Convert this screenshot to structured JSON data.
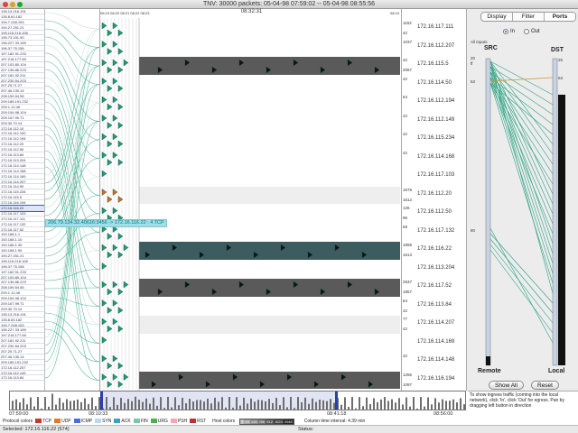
{
  "window": {
    "title": "TNV: 30000 packets: 05-04-98 07:59:02 -- 05-04-98 08:55:56"
  },
  "matrix": {
    "center_time": "08:32:31",
    "top_labels": "08:19 08:20 08:21 08:22 08:23",
    "right_top_label": "08:24",
    "rows": [
      {
        "ip": "172.16.117.111",
        "count_top": "1163",
        "count_bot": "42",
        "bg": "#ffffff"
      },
      {
        "ip": "172.16.112.207",
        "count_top": "1037",
        "count_bot": "",
        "bg": "#ffffff"
      },
      {
        "ip": "172.16.115.5",
        "count_top": "42",
        "count_bot": "2067",
        "bg": "#5a5a5a"
      },
      {
        "ip": "172.16.114.50",
        "count_top": "42",
        "count_bot": "",
        "bg": "#ffffff"
      },
      {
        "ip": "172.16.112.194",
        "count_top": "54",
        "count_bot": "",
        "bg": "#ffffff"
      },
      {
        "ip": "172.16.112.149",
        "count_top": "42",
        "count_bot": "",
        "bg": "#ffffff"
      },
      {
        "ip": "172.16.115.234",
        "count_top": "42",
        "count_bot": "",
        "bg": "#ffffff"
      },
      {
        "ip": "172.16.114.168",
        "count_top": "42",
        "count_bot": "",
        "bg": "#ffffff"
      },
      {
        "ip": "172.16.117.103",
        "count_top": "",
        "count_bot": "",
        "bg": "#ffffff"
      },
      {
        "ip": "172.16.112.20",
        "count_top": "1678",
        "count_bot": "1612",
        "bg": "#eeeeee"
      },
      {
        "ip": "172.16.112.50",
        "count_top": "126",
        "count_bot": "96",
        "bg": "#ffffff"
      },
      {
        "ip": "172.16.117.132",
        "count_top": "69",
        "count_bot": "",
        "bg": "#ffffff"
      },
      {
        "ip": "172.16.116.22",
        "count_top": "1968",
        "count_bot": "1513",
        "bg": "#3d5c60"
      },
      {
        "ip": "172.16.113.204",
        "count_top": "",
        "count_bot": "",
        "bg": "#ffffff"
      },
      {
        "ip": "172.16.117.52",
        "count_top": "2537",
        "count_bot": "1857",
        "bg": "#5a5a5a"
      },
      {
        "ip": "172.16.113.84",
        "count_top": "64",
        "count_bot": "42",
        "bg": "#ffffff"
      },
      {
        "ip": "172.16.114.207",
        "count_top": "77",
        "count_bot": "42",
        "bg": "#eeeeee"
      },
      {
        "ip": "172.16.114.169",
        "count_top": "",
        "count_bot": "",
        "bg": "#ffffff"
      },
      {
        "ip": "172.16.114.148",
        "count_top": "42",
        "count_bot": "",
        "bg": "#ffffff"
      },
      {
        "ip": "172.16.116.194",
        "count_top": "1256",
        "count_bot": "1097",
        "bg": "#5a5a5a"
      }
    ]
  },
  "tooltip": {
    "text": "206.79.134.32.40616:3456 -> 172.16.116.22 : 4 TCP"
  },
  "panel": {
    "tabs": [
      "Display",
      "Filter",
      "Ports"
    ],
    "active_tab": "Ports",
    "radio_in": "In",
    "radio_out": "Out",
    "radio_selected": "In",
    "all_inputs": "All Inputs",
    "src_label": "SRC",
    "dst_label": "DST",
    "src_numbers": [
      "20",
      "ff",
      "53",
      "80"
    ],
    "dst_numbers": [
      "25",
      "53"
    ],
    "remote_label": "Remote",
    "local_label": "Local",
    "show_all_label": "Show All",
    "reset_label": "Reset"
  },
  "timeline": {
    "ticks": [
      "07:59:00",
      "08:10:33",
      "08:41:18",
      "08:56:00"
    ],
    "interval_label": "Column time interval: 4.39 min"
  },
  "legend": {
    "protocol_label": "Protocol colors",
    "protocols": [
      {
        "name": "TCP",
        "color": "#c0392b"
      },
      {
        "name": "UDP",
        "color": "#e07b2e"
      },
      {
        "name": "ICMP",
        "color": "#4a6fd4"
      },
      {
        "name": "SYN",
        "color": "#b9d8f0"
      },
      {
        "name": "ACK",
        "color": "#3aa0c8"
      },
      {
        "name": "FIN",
        "color": "#7ec6a8"
      },
      {
        "name": "URG",
        "color": "#48b04a"
      },
      {
        "name": "PSH",
        "color": "#f2a7b5"
      },
      {
        "name": "RST",
        "color": "#c03030"
      }
    ],
    "host_label": "Host colors",
    "host_scale": [
      "1",
      "53",
      "128",
      "256",
      "512",
      "1024",
      "2048"
    ]
  },
  "status": {
    "selected": "Selected:  172.16.116.22 (574)",
    "status": "Status:"
  },
  "help": {
    "text": "To show ingress traffic (coming into the local network), click 'In', click 'Out' for egress. Pan by dragging left button in direction"
  },
  "hostlist": {
    "items": [
      "135.13.216.191",
      "135.8.60.182",
      "194.7.248.153",
      "194.27.251.21",
      "195.115.218.108",
      "195.73.151.50",
      "196.227.33.189",
      "196.37.75.158",
      "197.182.91.233",
      "197.218.177.69",
      "207.103.80.104",
      "207.136.86.223",
      "207.181.92.211",
      "207.230.54.203",
      "207.25.71.27",
      "207.46.130.14",
      "208.159.54.55",
      "209.185.191.232",
      "209.1.12.46",
      "209.154.98.104",
      "209.167.99.71",
      "209.30.70.14",
      "172.16.112.10",
      "172.16.112.100",
      "172.16.112.194",
      "172.16.112.20",
      "172.16.112.50",
      "172.16.113.84",
      "172.16.113.204",
      "172.16.114.148",
      "172.16.114.168",
      "172.16.114.169",
      "172.16.114.207",
      "172.16.114.50",
      "172.16.115.234",
      "172.16.115.5",
      "172.16.116.194",
      "172.16.116.22",
      "172.16.117.103",
      "172.16.117.111",
      "172.16.117.132",
      "172.16.117.52",
      "192.168.1.1",
      "192.168.1.10",
      "192.168.1.30",
      "192.168.1.90",
      "194.27.251.21",
      "195.115.218.108",
      "196.37.75.158",
      "197.182.91.233",
      "207.103.80.104",
      "207.136.86.223",
      "208.159.54.55",
      "209.1.12.46",
      "209.154.98.104",
      "209.167.99.71",
      "209.30.70.14",
      "135.13.216.191",
      "135.8.60.182",
      "194.7.248.153",
      "196.227.33.189",
      "197.218.177.69",
      "207.181.92.211",
      "207.230.54.203",
      "207.25.71.27",
      "207.46.130.14",
      "209.185.191.232",
      "172.16.112.207",
      "172.16.112.149",
      "172.16.113.84"
    ]
  }
}
